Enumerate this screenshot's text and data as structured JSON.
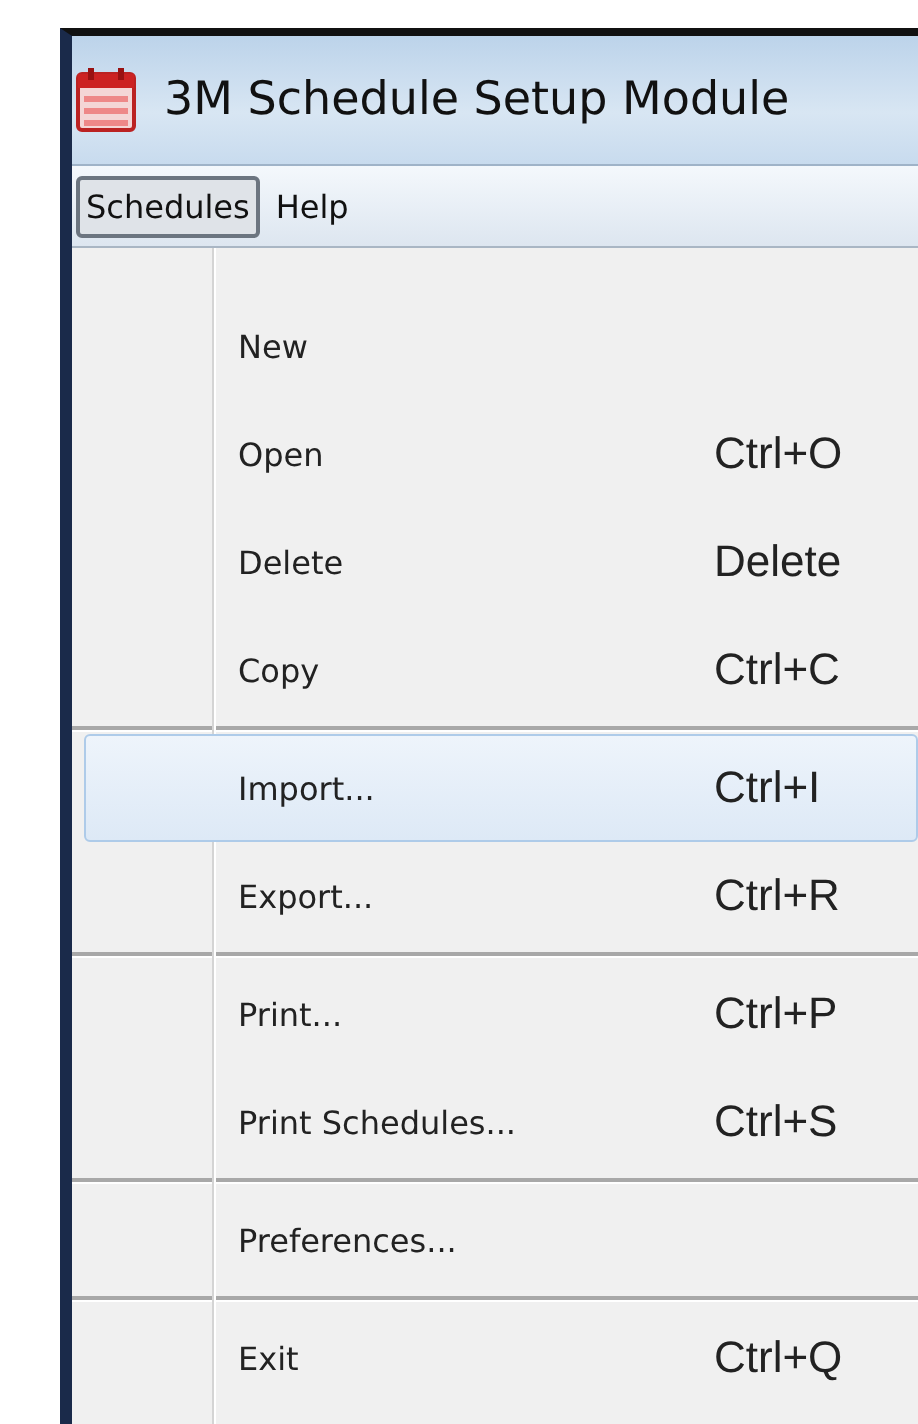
{
  "window": {
    "title": "3M Schedule Setup Module"
  },
  "menubar": [
    {
      "label": "Schedules",
      "selected": true
    },
    {
      "label": "Help",
      "selected": false
    }
  ],
  "menu": [
    {
      "kind": "item",
      "label": "New",
      "selected": false
    },
    {
      "kind": "item",
      "label": "Open",
      "shortcut": "Ctrl+O",
      "selected": false
    },
    {
      "kind": "item",
      "label": "Delete",
      "shortcut": "Delete",
      "selected": false
    },
    {
      "kind": "item",
      "label": "Copy",
      "shortcut": "Ctrl+C",
      "selected": false
    },
    {
      "kind": "separator"
    },
    {
      "kind": "item",
      "label": "Import...",
      "shortcut": "Ctrl+I",
      "selected": true
    },
    {
      "kind": "item",
      "label": "Export...",
      "shortcut": "Ctrl+R",
      "selected": false
    },
    {
      "kind": "separator"
    },
    {
      "kind": "item",
      "label": "Print...",
      "shortcut": "Ctrl+P",
      "selected": false
    },
    {
      "kind": "item",
      "label": "Print Schedules...",
      "shortcut": "Ctrl+S",
      "selected": false
    },
    {
      "kind": "separator"
    },
    {
      "kind": "item",
      "label": "Preferences...",
      "selected": false
    },
    {
      "kind": "separator"
    },
    {
      "kind": "item",
      "label": "Exit",
      "shortcut": "Ctrl+Q",
      "selected": false
    }
  ]
}
